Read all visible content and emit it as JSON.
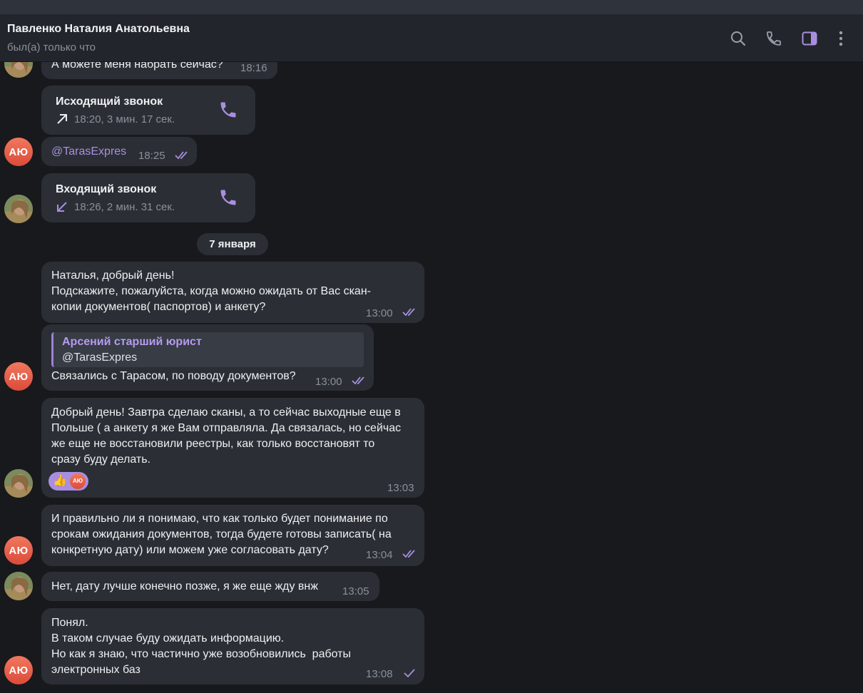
{
  "header": {
    "name": "Павленко Наталия Анатольевна",
    "status": "был(а) только что"
  },
  "icons": {
    "search": "search-icon",
    "call": "phone-icon",
    "sidebar": "sidebar-toggle-icon",
    "more": "more-vertical-icon"
  },
  "accent_color": "#a98ee0",
  "avatar_initials": "АЮ",
  "messages": {
    "m1": {
      "text": "А можете меня набрать сейчас?",
      "time": "18:16"
    },
    "call_out": {
      "title": "Исходящий звонок",
      "info": "18:20, 3 мин. 17 сек."
    },
    "m2": {
      "text": "@TarasExpres",
      "time": "18:25"
    },
    "call_in": {
      "title": "Входящий звонок",
      "info": "18:26, 2 мин. 31 сек."
    },
    "date": "7 января",
    "m3": {
      "text": "Наталья, добрый день!\nПодскажите, пожалуйста, когда можно ожидать от Вас скан-\nкопии документов( паспортов) и анкету?",
      "time": "13:00"
    },
    "m4": {
      "reply_name": "Арсений старший юрист",
      "reply_text": "@TarasExpres",
      "text": "Связались с Тарасом, по поводу документов?",
      "time": "13:00"
    },
    "m5": {
      "text": "Добрый день! Завтра сделаю сканы, а то сейчас выходные еще в\nПольше ( а анкету я же Вам отправляла. Да связалась, но сейчас\nже еще не восстановили реестры, как только восстановят то\nсразу буду делать.",
      "reaction_emoji": "👍",
      "reaction_user": "АЮ",
      "time": "13:03"
    },
    "m6": {
      "text": "И правильно ли я понимаю, что как только будет понимание по\nсрокам ожидания документов, тогда будете готовы записать( на\nконкретную дату) или можем уже согласовать дату?",
      "time": "13:04"
    },
    "m7": {
      "text": "Нет, дату лучше конечно позже, я же еще жду внж",
      "time": "13:05"
    },
    "m8": {
      "text": "Понял.\nВ таком случае буду ожидать информацию.\nНо как я знаю, что частично уже возобновились  работы\nэлектронных баз",
      "time": "13:08"
    }
  }
}
